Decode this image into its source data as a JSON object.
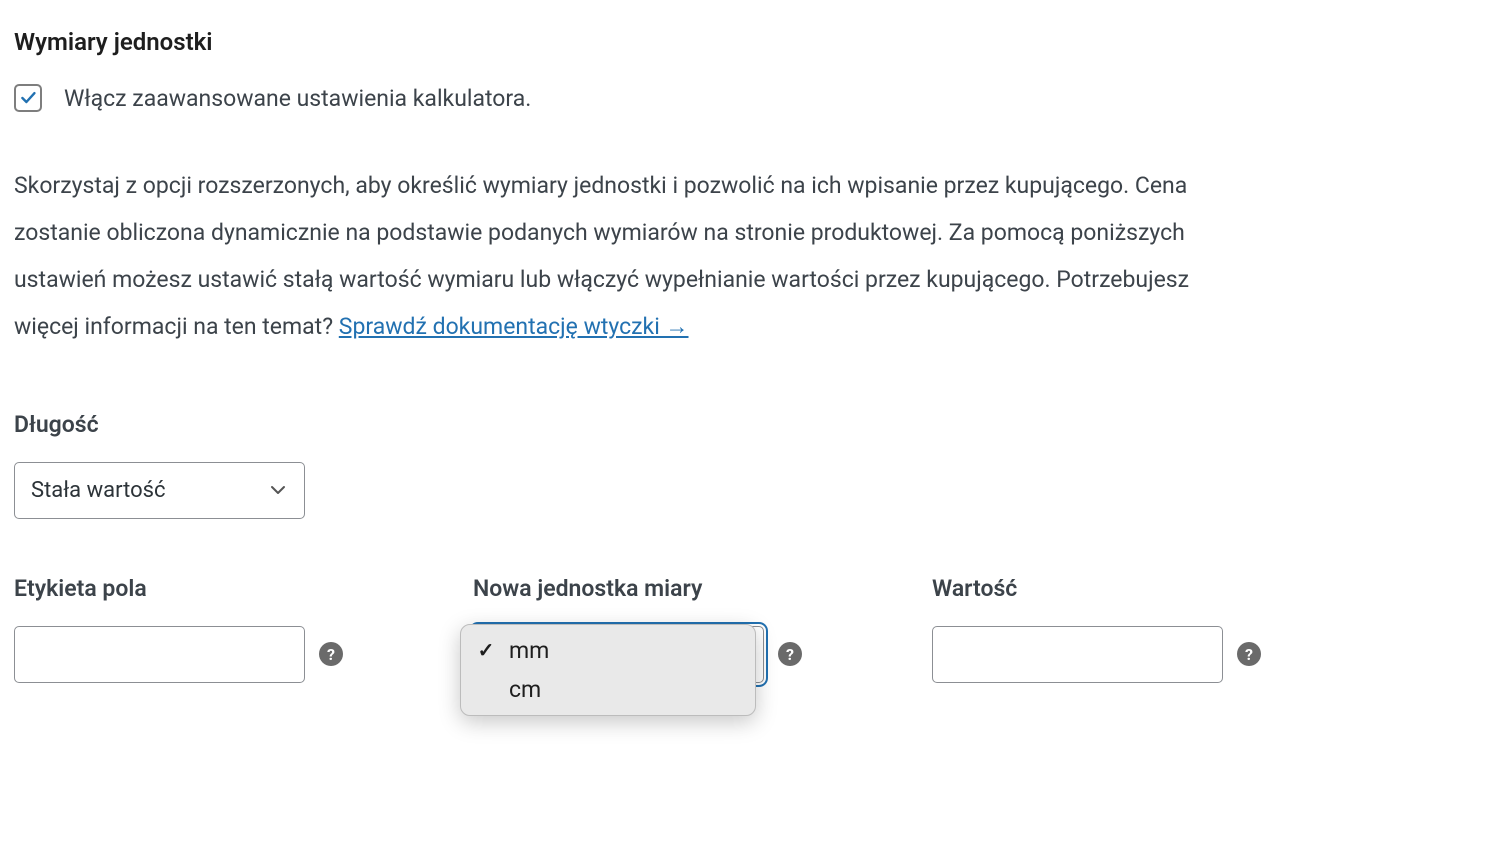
{
  "section": {
    "heading": "Wymiary jednostki",
    "checkbox_label": "Włącz zaawansowane ustawienia kalkulatora.",
    "checkbox_checked": true,
    "description": "Skorzystaj z opcji rozszerzonych, aby określić wymiary jednostki i pozwolić na ich wpisanie przez kupującego. Cena zostanie obliczona dynamicznie na podstawie podanych wymiarów na stronie produktowej. Za pomocą poniższych ustawień możesz ustawić stałą wartość wymiaru lub włączyć wypełnianie wartości przez kupującego. Potrzebujesz więcej informacji na ten temat? ",
    "docs_link_text": "Sprawdź dokumentację wtyczki →"
  },
  "length": {
    "heading": "Długość",
    "mode_select": "Stała wartość",
    "fields": {
      "label": {
        "title": "Etykieta pola",
        "value": ""
      },
      "unit": {
        "title": "Nowa jednostka miary",
        "options": [
          "mm",
          "cm"
        ],
        "selected": "mm"
      },
      "value": {
        "title": "Wartość",
        "value": ""
      }
    }
  },
  "icons": {
    "help": "?"
  }
}
